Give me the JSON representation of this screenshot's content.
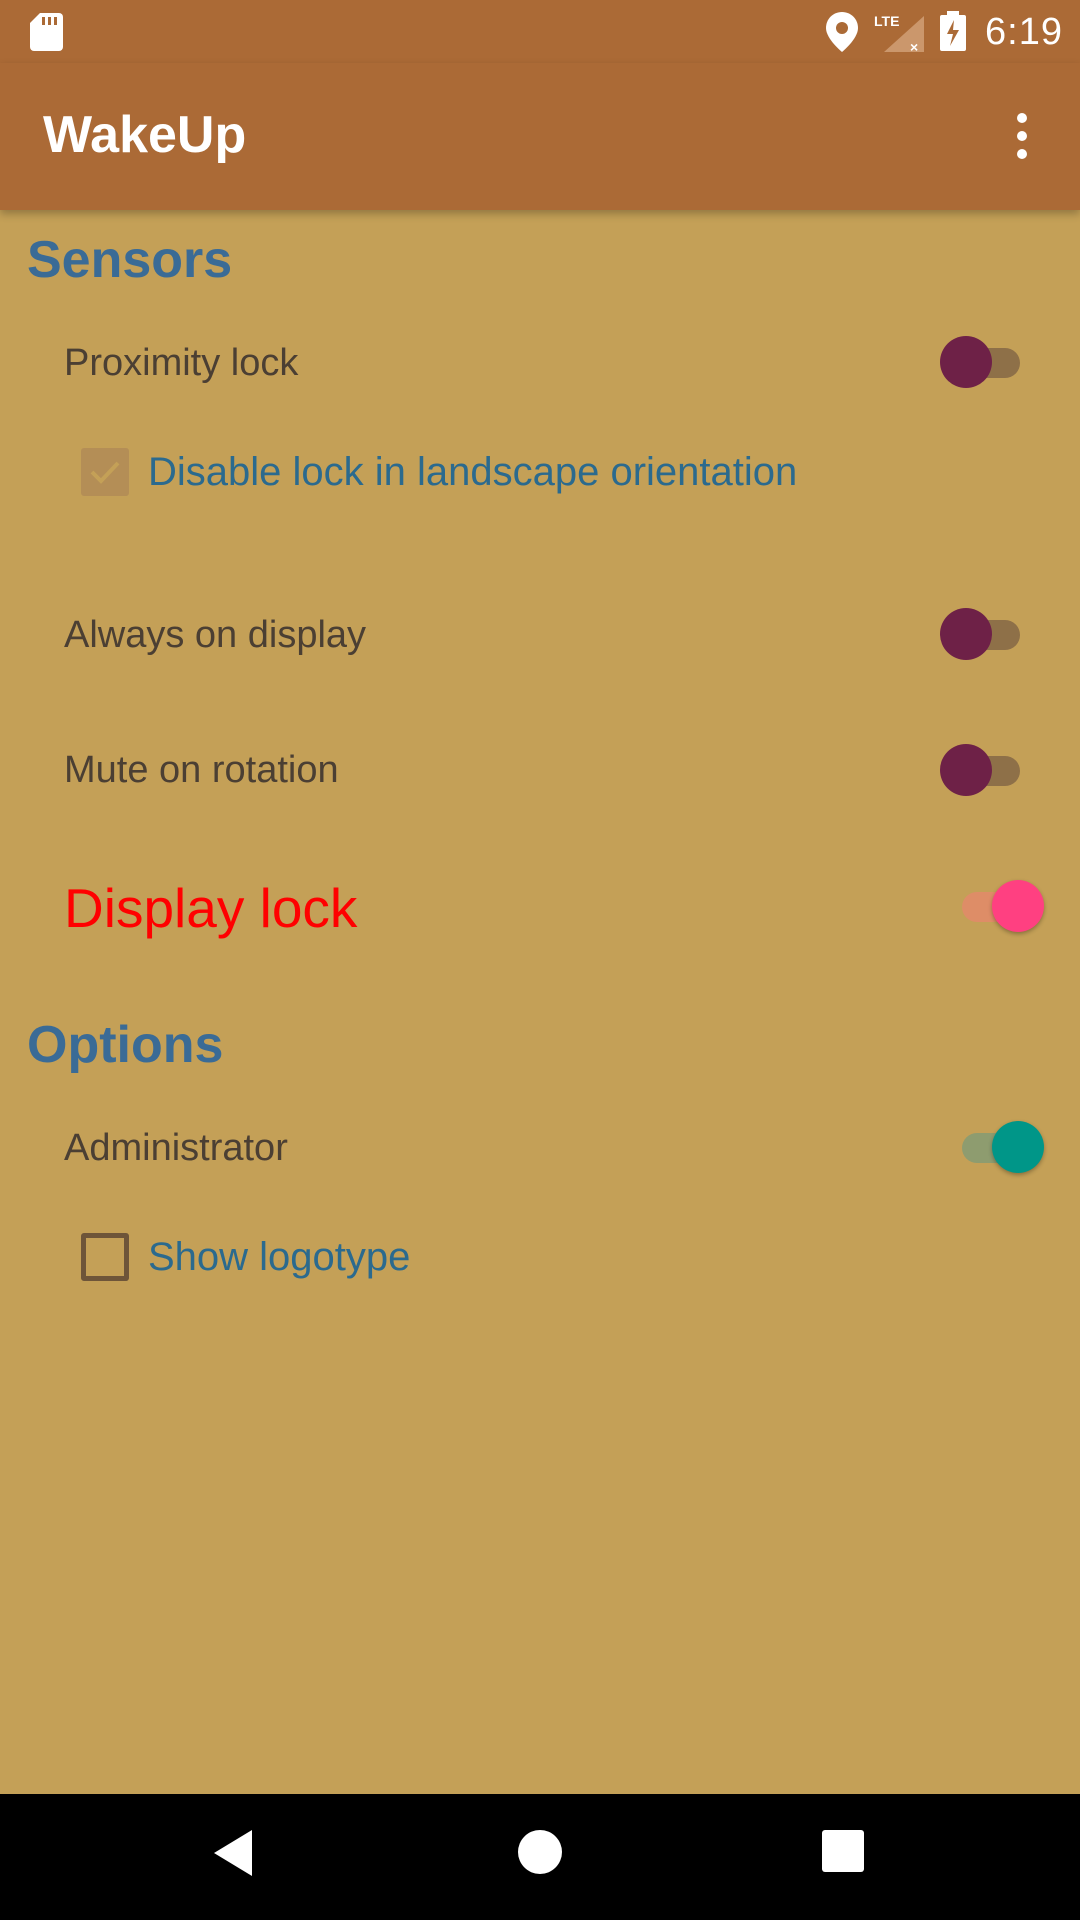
{
  "status_bar": {
    "time": "6:19",
    "network": "LTE",
    "icons": [
      "sd-card-icon",
      "location-icon",
      "signal-icon",
      "battery-charging-icon"
    ]
  },
  "app_bar": {
    "title": "WakeUp",
    "menu_icon": "more-vert-icon"
  },
  "sections": {
    "sensors": {
      "title": "Sensors",
      "proximity_lock": {
        "label": "Proximity lock",
        "enabled": false
      },
      "disable_landscape": {
        "label": "Disable lock in landscape orientation",
        "checked": true
      },
      "always_on": {
        "label": "Always on display",
        "enabled": false
      },
      "mute_rotation": {
        "label": "Mute on rotation",
        "enabled": false
      },
      "display_lock": {
        "label": "Display lock",
        "enabled": true
      }
    },
    "options": {
      "title": "Options",
      "administrator": {
        "label": "Administrator",
        "enabled": true
      },
      "show_logotype": {
        "label": "Show logotype",
        "checked": false
      }
    }
  },
  "colors": {
    "app_bar": "#ab6a36",
    "background": "#c4a057",
    "section_title": "#3a6b96",
    "switch_off_thumb": "#6e2147",
    "switch_on_pink": "#ff4081",
    "switch_on_teal": "#009688",
    "display_lock_text": "#ff0000"
  },
  "nav_bar": {
    "icons": [
      "back-icon",
      "home-icon",
      "recents-icon"
    ]
  }
}
